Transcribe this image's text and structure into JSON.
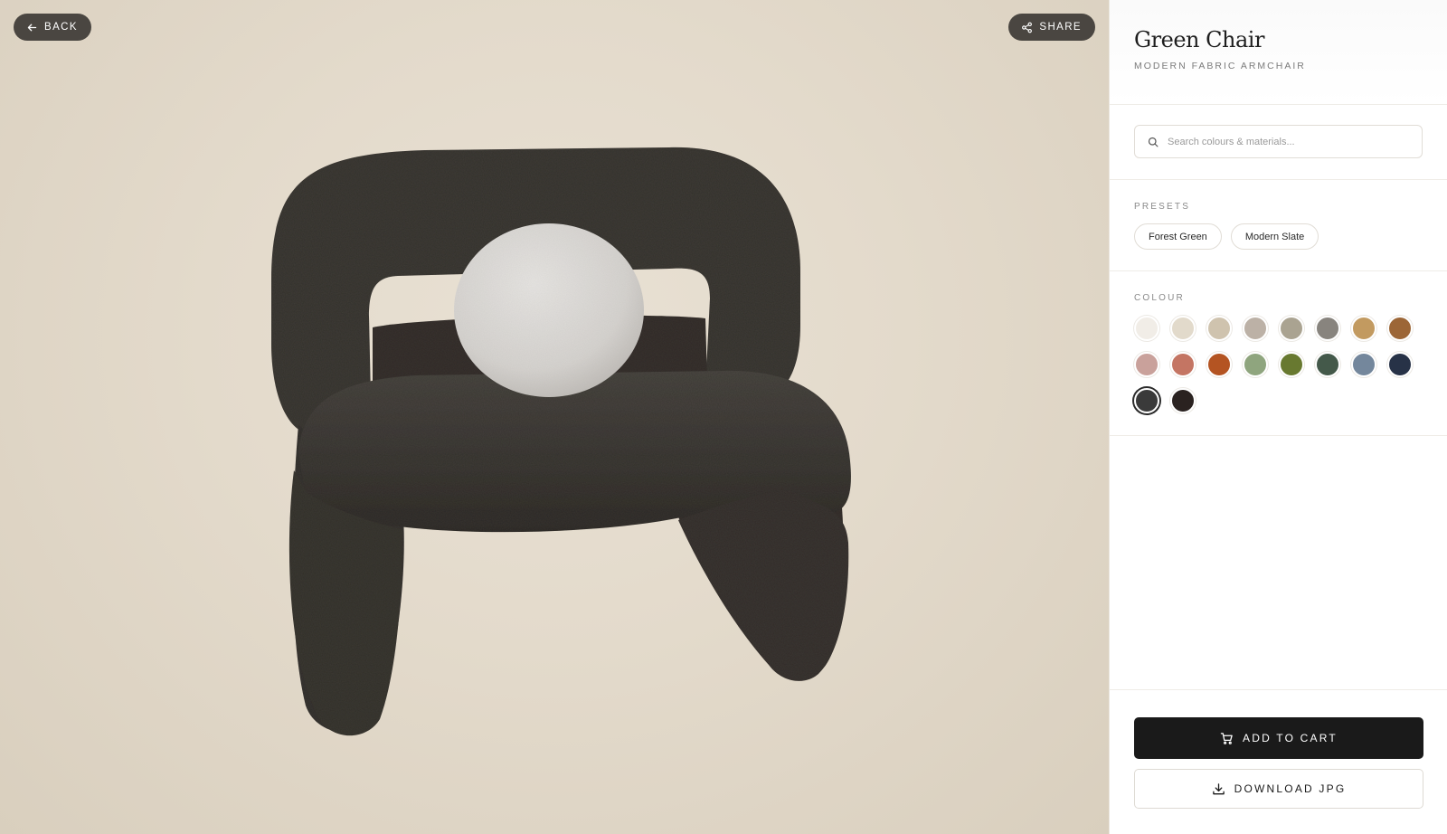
{
  "viewer": {
    "back_label": "BACK",
    "share_label": "SHARE",
    "background_color": "#e6ddcf"
  },
  "product": {
    "title": "Green Chair",
    "subtitle": "MODERN FABRIC ARMCHAIR",
    "chair_color": "#3f3b37",
    "cushion_color": "#dddbd8"
  },
  "search": {
    "placeholder": "Search colours & materials...",
    "value": ""
  },
  "presets": {
    "label": "PRESETS",
    "items": [
      "Forest Green",
      "Modern Slate"
    ]
  },
  "colour": {
    "label": "COLOUR",
    "selected_index": 16,
    "swatches": [
      "#f1ede7",
      "#e2dacb",
      "#cfc3ae",
      "#bcb1a6",
      "#aaa391",
      "#88847e",
      "#c29a60",
      "#9c6637",
      "#c9a19b",
      "#c47563",
      "#b45422",
      "#8fa57e",
      "#687930",
      "#44594a",
      "#74879c",
      "#273247",
      "#3a3a3a",
      "#2a2220"
    ]
  },
  "actions": {
    "add_to_cart": "ADD TO CART",
    "download": "DOWNLOAD JPG"
  },
  "icons": {
    "back": "arrow-left-icon",
    "share": "share-icon",
    "search": "search-icon",
    "cart": "cart-icon",
    "download": "download-icon"
  }
}
